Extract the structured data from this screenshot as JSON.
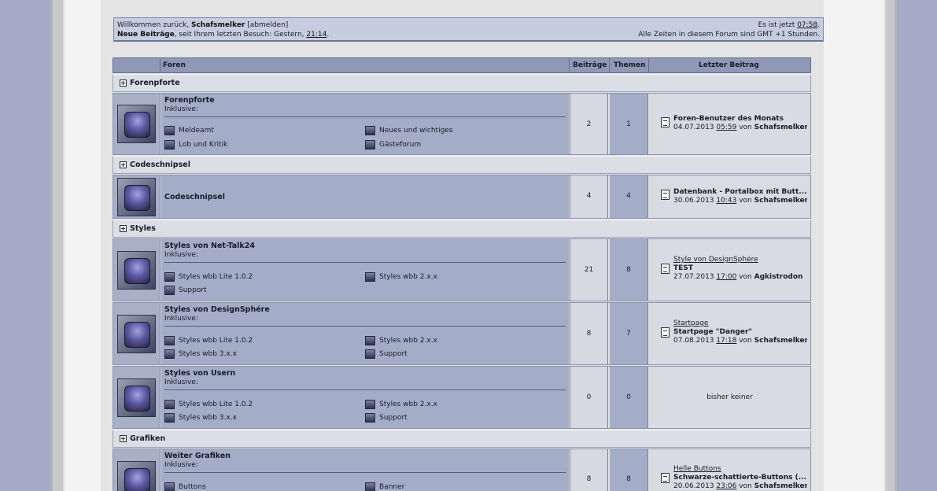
{
  "infobar": {
    "welcome_prefix": "Willkommen zurück,",
    "username": "Schafsmelker",
    "logout": "[abmelden]",
    "new_posts_label": "Neue Beiträge",
    "since_text": ", seit Ihrem letzten Besuch: Gestern,",
    "since_time": "21:14",
    "since_end": ".",
    "now_prefix": "Es ist jetzt",
    "now_time": "07:58",
    "now_end": ".",
    "timezone": "Alle Zeiten in diesem Forum sind GMT +1 Stunden."
  },
  "header": {
    "forums": "Foren",
    "posts": "Beiträge",
    "topics": "Themen",
    "last_post": "Letzter Beitrag"
  },
  "categories": {
    "c1": "Forenpforte",
    "c2": "Codeschnipsel",
    "c3": "Styles",
    "c4": "Grafiken"
  },
  "plus_symbol": "+",
  "inclusive_label": "Inklusive:",
  "by_label": "von",
  "forums": {
    "f1": {
      "title": "Forenpforte",
      "subs": [
        "Meldeamt",
        "Neues und wichtiges",
        "Lob und Kritik",
        "Gästeforum"
      ],
      "posts": "2",
      "topics": "1",
      "last_title": "Foren-Benutzer des Monats",
      "last_date": "04.07.2013",
      "last_time": "05:59",
      "last_user": "Schafsmelker"
    },
    "f2": {
      "title": "Codeschnipsel",
      "posts": "4",
      "topics": "4",
      "last_title": "Datenbank - Portalbox mit Butt...",
      "last_date": "30.06.2013",
      "last_time": "10:43",
      "last_user": "Schafsmelker"
    },
    "f3": {
      "title": "Styles von Net-Talk24",
      "subs": [
        "Styles wbb Lite 1.0.2",
        "Styles wbb 2.x.x",
        "Support"
      ],
      "posts": "21",
      "topics": "8",
      "last_forum": "Style von DesignSphére",
      "last_title": "TEST",
      "last_date": "27.07.2013",
      "last_time": "17:00",
      "last_user": "Agkistrodon"
    },
    "f4": {
      "title": "Styles von DesignSphére",
      "subs": [
        "Styles wbb Lite 1.0.2",
        "Styles wbb 2.x.x",
        "Styles wbb 3.x.x",
        "Support"
      ],
      "posts": "8",
      "topics": "7",
      "last_forum": "Startpage",
      "last_title": "Startpage \"Danger\"",
      "last_date": "07.08.2013",
      "last_time": "17:18",
      "last_user": "Schafsmelker"
    },
    "f5": {
      "title": "Styles von Usern",
      "subs": [
        "Styles wbb Lite 1.0.2",
        "Styles wbb 2.x.x",
        "Styles wbb 3.x.x",
        "Support"
      ],
      "posts": "0",
      "topics": "0",
      "none_text": "bisher keiner"
    },
    "f6": {
      "title": "Weiter Grafiken",
      "subs": [
        "Buttons",
        "Banner"
      ],
      "posts": "8",
      "topics": "8",
      "last_forum": "Helle Buttons",
      "last_title": "Schwarze-schattierte-Buttons (...",
      "last_date": "20.06.2013",
      "last_time": "23:06",
      "last_user": "Schafsmelker"
    }
  }
}
